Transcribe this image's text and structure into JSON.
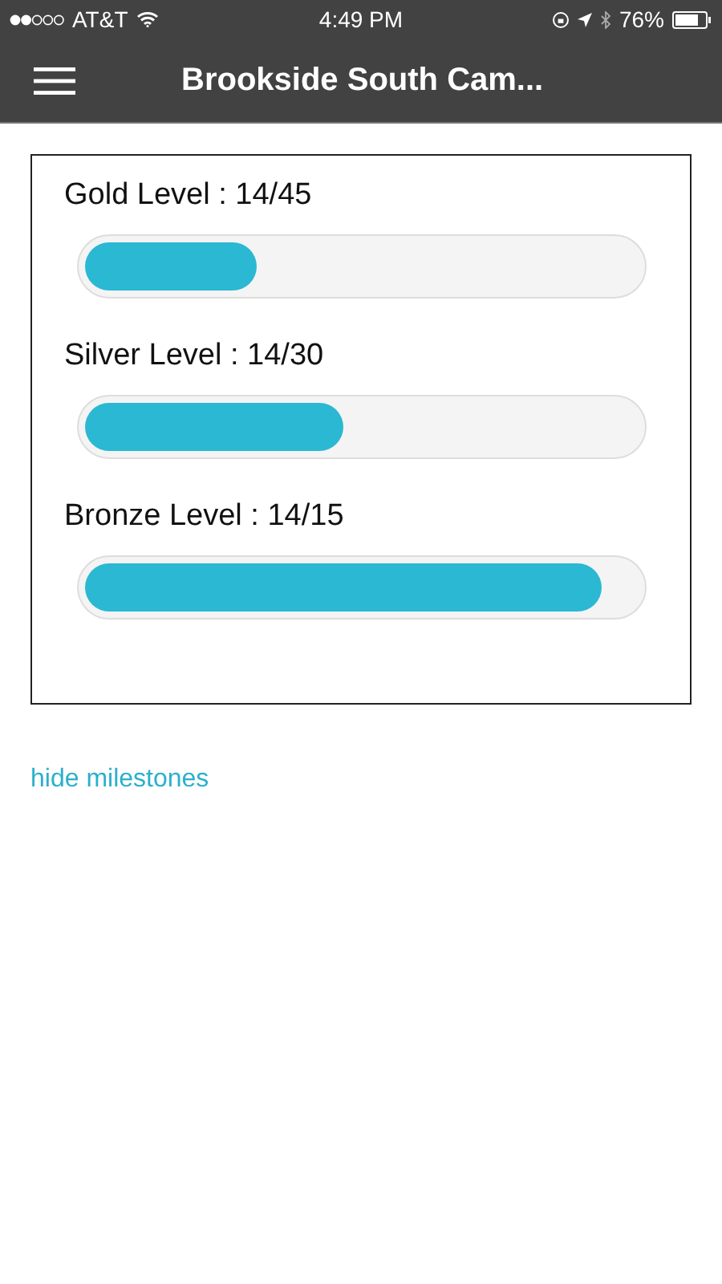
{
  "status_bar": {
    "carrier": "AT&T",
    "time": "4:49 PM",
    "battery": "76%"
  },
  "header": {
    "title": "Brookside South Cam..."
  },
  "milestones": [
    {
      "label": "Gold Level : 14/45",
      "level": 0.31
    },
    {
      "label": "Silver Level : 14/30",
      "level": 0.467
    },
    {
      "label": "Bronze Level : 14/15",
      "level": 0.933
    }
  ],
  "toggle_link": "hide milestones"
}
